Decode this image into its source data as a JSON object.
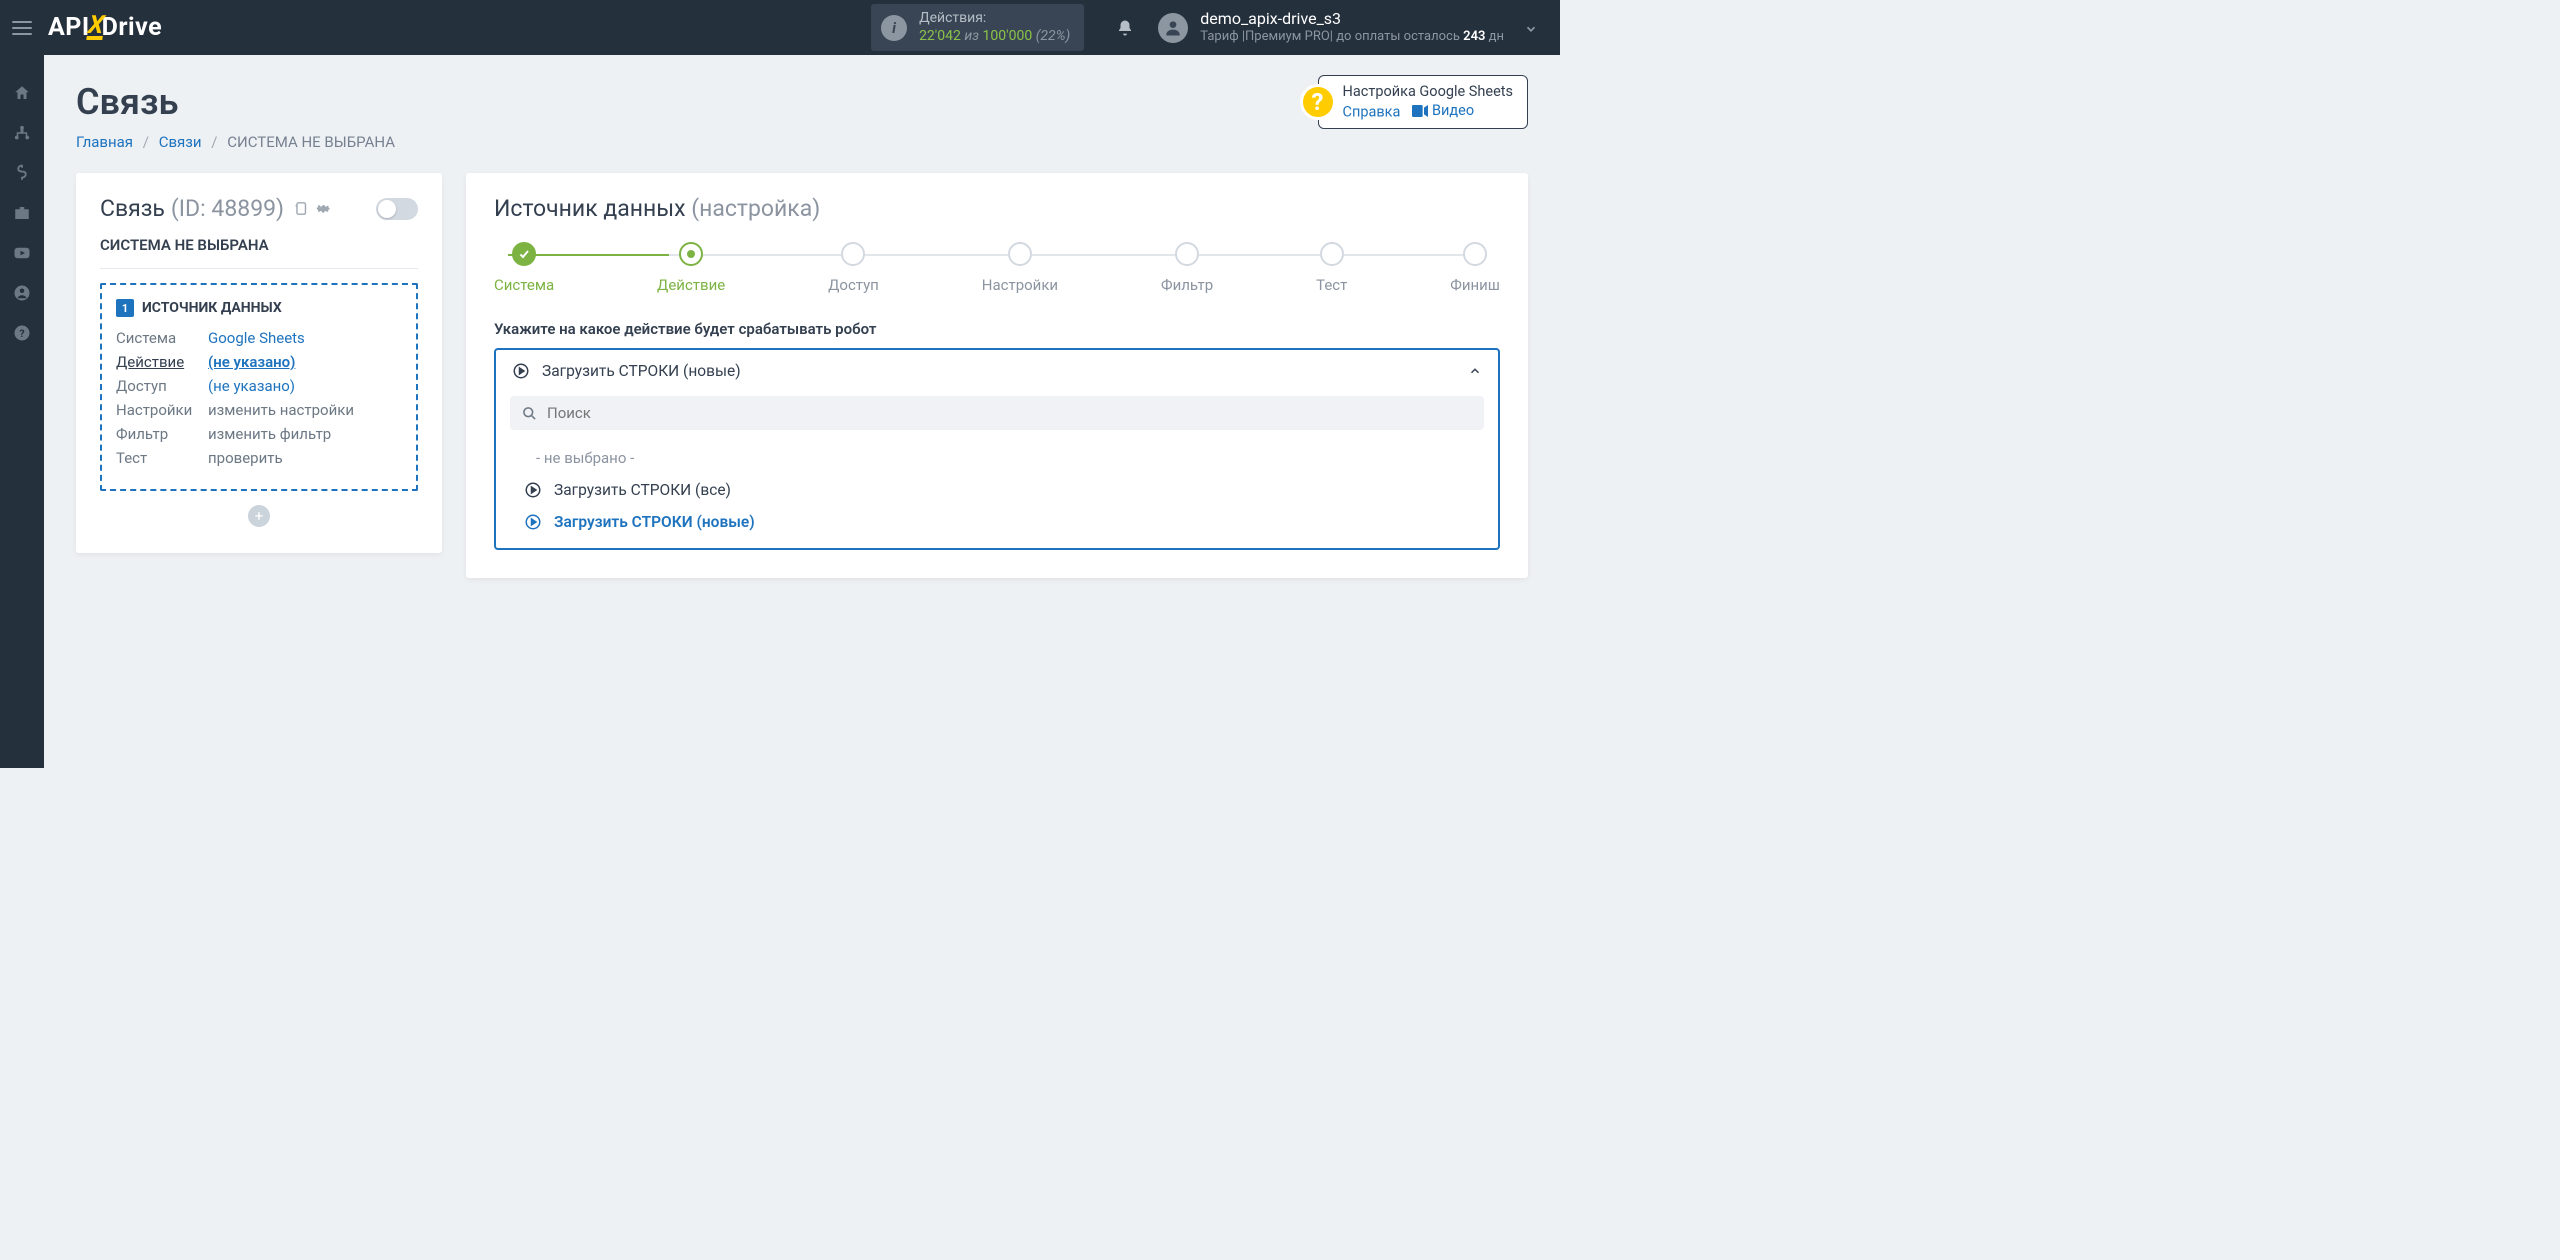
{
  "topbar": {
    "logo_api": "API",
    "logo_drive": "Drive",
    "actions": {
      "label": "Действия:",
      "count": "22'042",
      "of": "из",
      "total": "100'000",
      "percent": "(22%)"
    },
    "user": {
      "name": "demo_apix-drive_s3",
      "tariff_prefix": "Тариф |Премиум PRO| до оплаты осталось",
      "days": "243",
      "days_suffix": "дн"
    }
  },
  "page": {
    "title": "Связь",
    "breadcrumb": {
      "home": "Главная",
      "links": "Связи",
      "current": "СИСТЕМА НЕ ВЫБРАНА"
    }
  },
  "help": {
    "title": "Настройка Google Sheets",
    "ref": "Справка",
    "video": "Видео"
  },
  "left_card": {
    "title": "Связь",
    "id": "(ID: 48899)",
    "subtitle": "СИСТЕМА НЕ ВЫБРАНА",
    "source_header": "ИСТОЧНИК ДАННЫХ",
    "badge": "1",
    "rows": {
      "system_label": "Система",
      "system_value": "Google Sheets",
      "action_label": "Действие",
      "action_value": "(не указано)",
      "access_label": "Доступ",
      "access_value": "(не указано)",
      "settings_label": "Настройки",
      "settings_value": "изменить настройки",
      "filter_label": "Фильтр",
      "filter_value": "изменить фильтр",
      "test_label": "Тест",
      "test_value": "проверить"
    }
  },
  "right_card": {
    "title": "Источник данных",
    "title_muted": "(настройка)",
    "steps": [
      "Система",
      "Действие",
      "Доступ",
      "Настройки",
      "Фильтр",
      "Тест",
      "Финиш"
    ],
    "form_label": "Укажите на какое действие будет срабатывать робот",
    "dropdown": {
      "selected": "Загрузить СТРОКИ (новые)",
      "search_placeholder": "Поиск",
      "empty_option": "- не выбрано -",
      "option_all": "Загрузить СТРОКИ (все)",
      "option_new": "Загрузить СТРОКИ (новые)"
    }
  }
}
